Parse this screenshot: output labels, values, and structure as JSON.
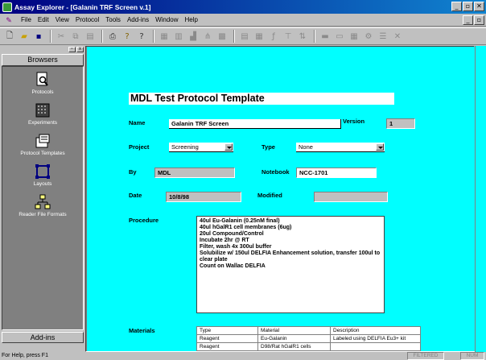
{
  "window": {
    "title": "Assay Explorer - [Galanin TRF Screen v.1]",
    "buttons": [
      "_",
      "▫",
      "✕"
    ]
  },
  "menubar": {
    "items": [
      {
        "label": "File"
      },
      {
        "label": "Edit"
      },
      {
        "label": "View"
      },
      {
        "label": "Protocol"
      },
      {
        "label": "Tools"
      },
      {
        "label": "Add-ins"
      },
      {
        "label": "Window"
      },
      {
        "label": "Help"
      }
    ],
    "mdi_buttons": [
      "_",
      "▫"
    ]
  },
  "toolbar": {
    "icons": [
      "new-file-icon",
      "open-folder-icon",
      "save-icon",
      "cut-icon",
      "copy-icon",
      "paste-icon",
      "print-icon",
      "help-icon",
      "context-help-icon",
      "table-icon",
      "grid-icon",
      "chart-icon",
      "tree-icon",
      "grid-view-icon",
      "layout-icon",
      "spreadsheet-icon",
      "formula-icon",
      "filter-icon",
      "sort-icon",
      "plate-icon",
      "save-layout-icon",
      "plate-grid-icon",
      "settings-icon",
      "list-icon",
      "close-icon"
    ]
  },
  "sidebar": {
    "header": "Browsers",
    "items": [
      {
        "label": "Protocols",
        "icon": "protocols-icon"
      },
      {
        "label": "Experiments",
        "icon": "experiments-icon"
      },
      {
        "label": "Protocol Templates",
        "icon": "protocol-templates-icon"
      },
      {
        "label": "Layouts",
        "icon": "layouts-icon"
      },
      {
        "label": "Reader File Formats",
        "icon": "reader-file-formats-icon"
      }
    ],
    "footer": "Add-ins"
  },
  "form": {
    "title": "MDL Test Protocol Template",
    "name_label": "Name",
    "name_value": "Galanin TRF Screen",
    "version_label": "Version",
    "version_value": "1",
    "project_label": "Project",
    "project_value": "Screening",
    "type_label": "Type",
    "type_value": "None",
    "by_label": "By",
    "by_value": "MDL",
    "notebook_label": "Notebook",
    "notebook_value": "NCC-1701",
    "date_label": "Date",
    "date_value": "10/8/98",
    "modified_label": "Modified",
    "modified_value": "",
    "procedure_label": "Procedure",
    "procedure_lines": [
      "40ul Eu-Galanin (0.25nM final)",
      "40ul hGalR1 cell membranes (6ug)",
      "20ul Compound/Control",
      "Incubate 2hr @ RT",
      "Filter, wash 4x 300ul buffer",
      "Solubilize w/ 150ul DELFIA Enhancement solution, transfer 100ul to clear plate",
      "Count on Wallac DELFIA"
    ],
    "materials_label": "Materials",
    "materials": {
      "headers": [
        "Type",
        "Material",
        "Description"
      ],
      "rows": [
        [
          "Reagent",
          "Eu-Galanin",
          "Labeled using DELFIA Eu3+ kit"
        ],
        [
          "Reagent",
          "D98/Rat hGalR1 cells",
          ""
        ]
      ]
    }
  },
  "statusbar": {
    "help": "For Help, press F1",
    "filtered": "FILTERED",
    "num": "NUM"
  }
}
